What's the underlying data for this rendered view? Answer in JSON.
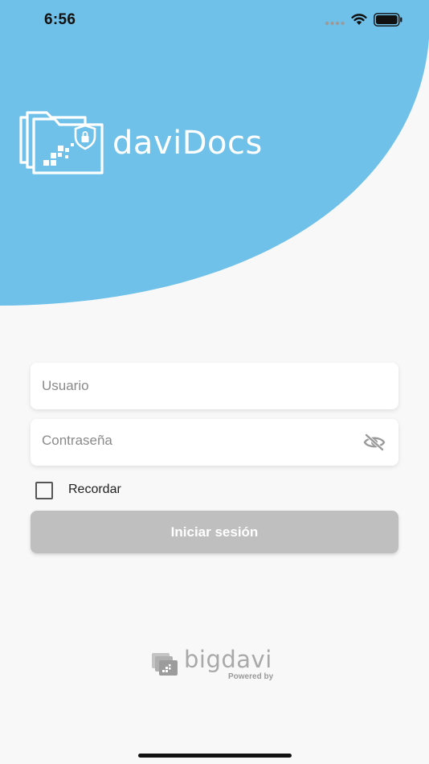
{
  "status_bar": {
    "time": "6:56"
  },
  "brand": {
    "app_name": "daviDocs",
    "color_primary": "#6fc1e9"
  },
  "login": {
    "username_placeholder": "Usuario",
    "username_value": "",
    "password_placeholder": "Contraseña",
    "password_value": "",
    "remember_label": "Recordar",
    "remember_checked": false,
    "submit_label": "Iniciar sesión",
    "submit_color": "#bfbfbf",
    "password_toggle_icon": "eye-off-icon"
  },
  "footer": {
    "company": "bigdavi",
    "powered_by": "Powered by"
  }
}
